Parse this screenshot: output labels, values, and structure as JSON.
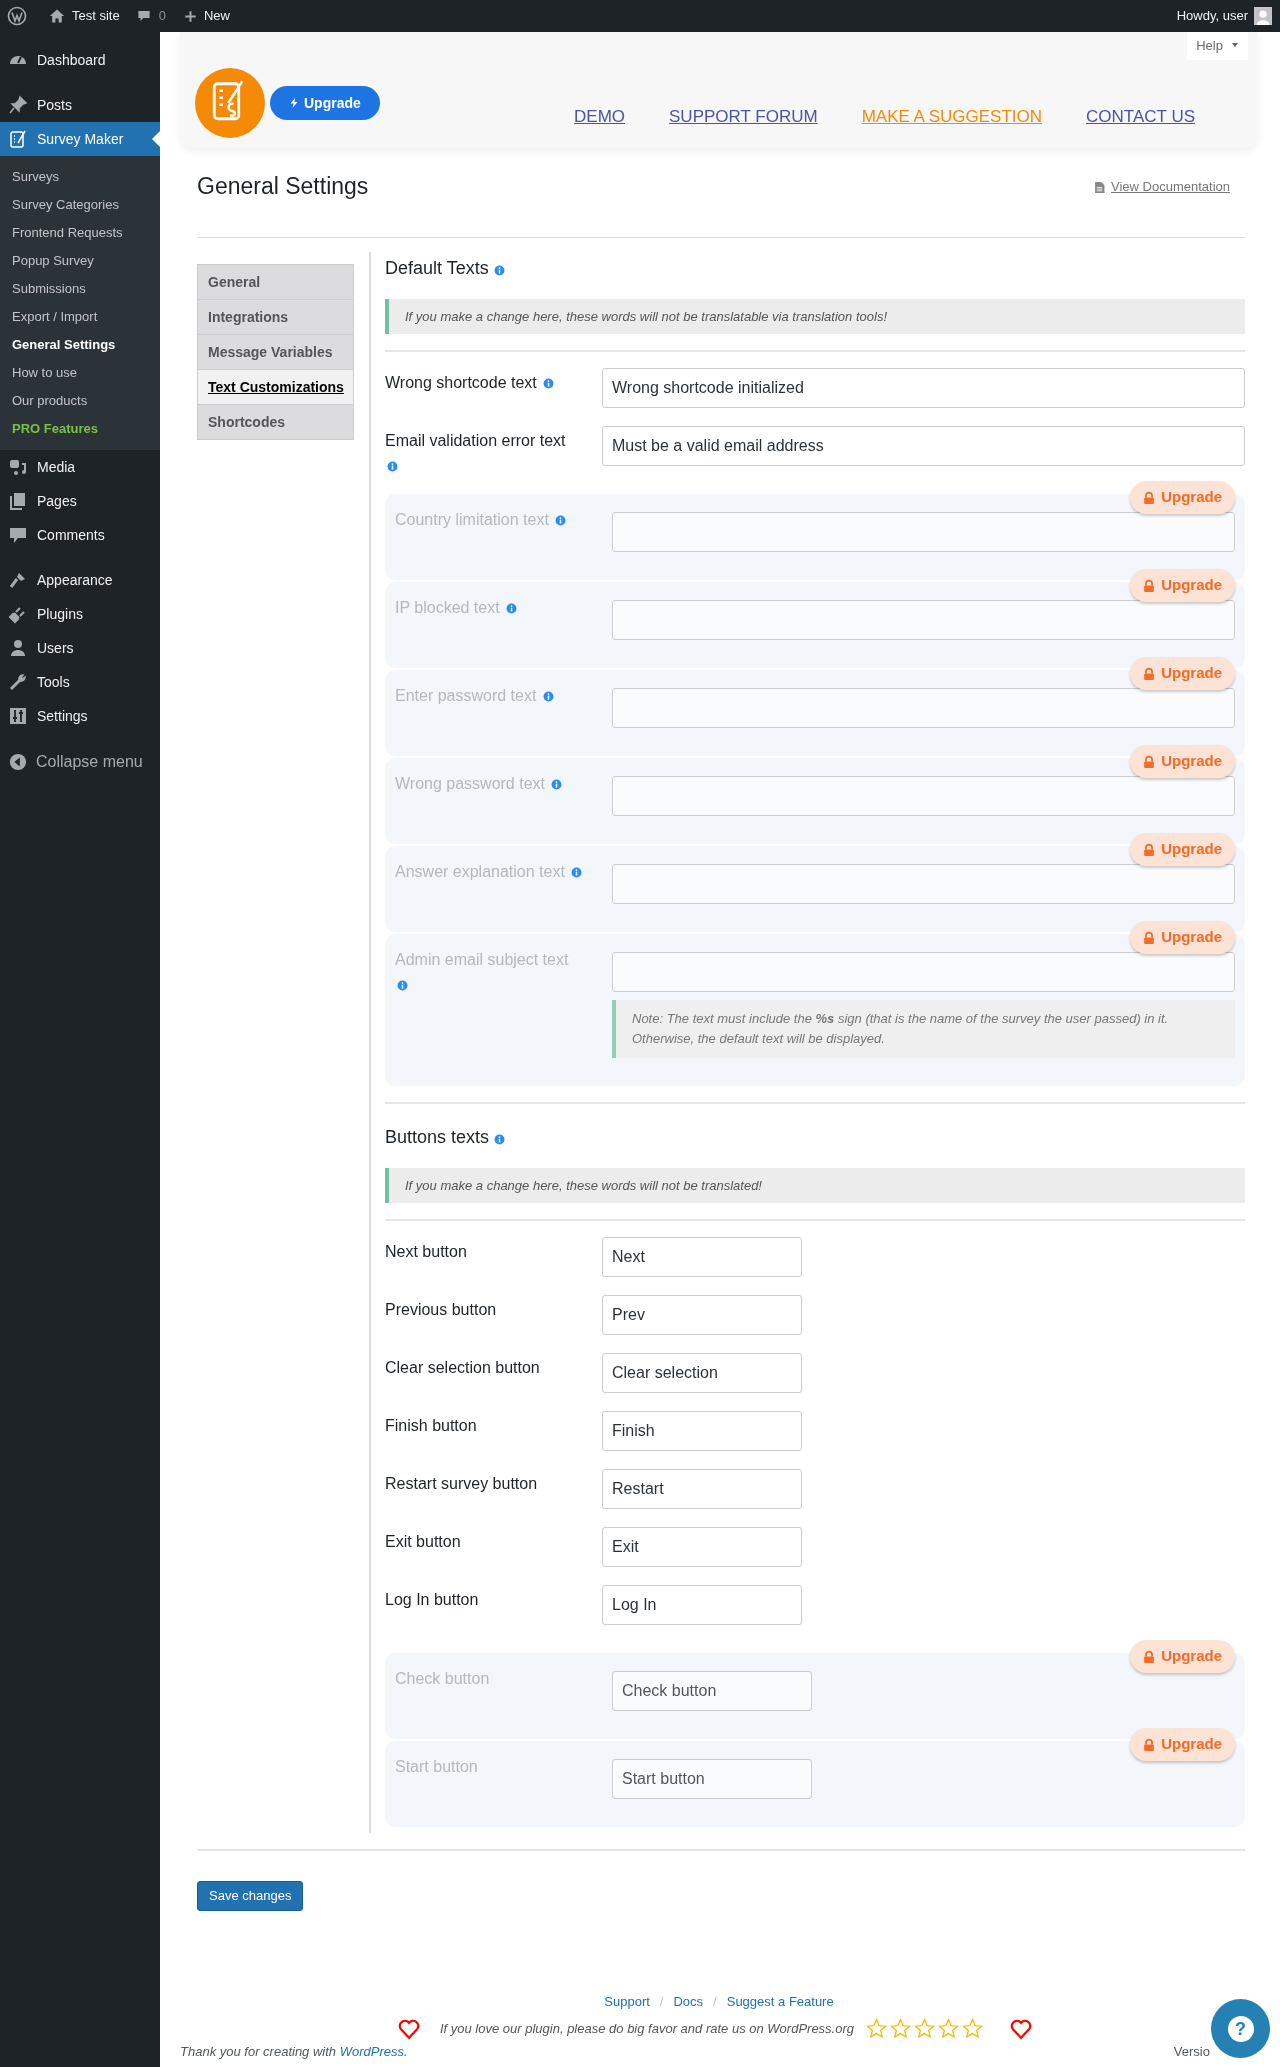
{
  "admin_bar": {
    "site": "Test site",
    "comments": "0",
    "new": "New",
    "greeting": "Howdy, user"
  },
  "sidebar": {
    "groups": [
      [
        {
          "label": "Dashboard",
          "selected": false
        }
      ],
      [
        {
          "label": "Posts",
          "selected": false
        },
        {
          "label": "Survey Maker",
          "selected": true,
          "children": [
            {
              "label": "Surveys",
              "kind": "link",
              "selected": false
            },
            {
              "label": "Survey Categories",
              "kind": "link",
              "selected": false
            },
            {
              "label": "Frontend Requests",
              "kind": "link",
              "selected": false
            },
            {
              "label": "Popup Survey",
              "kind": "link",
              "selected": false
            },
            {
              "label": "Submissions",
              "kind": "link",
              "selected": false
            },
            {
              "label": "Export / Import",
              "kind": "link",
              "selected": false
            },
            {
              "label": "General Settings",
              "kind": "link",
              "selected": true
            },
            {
              "label": "How to use",
              "kind": "link",
              "selected": false
            },
            {
              "label": "Our products",
              "kind": "link",
              "selected": false
            },
            {
              "label": "PRO Features",
              "kind": "pro",
              "selected": false
            }
          ]
        },
        {
          "label": "Media",
          "selected": false
        },
        {
          "label": "Pages",
          "selected": false
        },
        {
          "label": "Comments",
          "selected": false
        }
      ],
      [
        {
          "label": "Appearance",
          "selected": false
        },
        {
          "label": "Plugins",
          "selected": false
        },
        {
          "label": "Users",
          "selected": false
        },
        {
          "label": "Tools",
          "selected": false
        },
        {
          "label": "Settings",
          "selected": false
        }
      ]
    ],
    "collapse": "Collapse menu"
  },
  "header": {
    "upgrade": "Upgrade",
    "help": "Help",
    "links": [
      {
        "label": "DEMO",
        "highlighted": false
      },
      {
        "label": "SUPPORT FORUM",
        "highlighted": false
      },
      {
        "label": "MAKE A SUGGESTION",
        "highlighted": true
      },
      {
        "label": "CONTACT US",
        "highlighted": false
      }
    ]
  },
  "page": {
    "title": "General Settings",
    "doc_link": "View Documentation"
  },
  "tabs": [
    {
      "label": "General",
      "selected": false
    },
    {
      "label": "Integrations",
      "selected": false
    },
    {
      "label": "Message Variables",
      "selected": false
    },
    {
      "label": "Text Customizations",
      "selected": true
    },
    {
      "label": "Shortcodes",
      "selected": false
    }
  ],
  "sections": [
    {
      "title": "Default Texts",
      "kind": "texts",
      "notice": "If you make a change here, these words will not be translatable via translation tools!",
      "rows": [
        {
          "label": "Wrong shortcode text",
          "info": true,
          "locked": false,
          "value": "Wrong shortcode initialized"
        },
        {
          "label": "Email validation error text",
          "info": true,
          "locked": false,
          "value": "Must be a valid email address"
        },
        {
          "label": "Country limitation text",
          "info": true,
          "locked": true,
          "badge": "Upgrade"
        },
        {
          "label": "IP blocked text",
          "info": true,
          "locked": true,
          "badge": "Upgrade"
        },
        {
          "label": "Enter password text",
          "info": true,
          "locked": true,
          "badge": "Upgrade"
        },
        {
          "label": "Wrong password text",
          "info": true,
          "locked": true,
          "badge": "Upgrade"
        },
        {
          "label": "Answer explanation text",
          "info": true,
          "locked": true,
          "badge": "Upgrade"
        },
        {
          "label": "Admin email subject text",
          "info": true,
          "locked": true,
          "badge": "Upgrade",
          "note": "Note: The text must include the **%s** sign (that is the name of the survey the user passed) in it. Otherwise, the default text will be displayed."
        }
      ]
    },
    {
      "title": "Buttons texts",
      "kind": "buttons",
      "notice": "If you make a change here, these words will not be translated!",
      "rows": [
        {
          "label": "Next button",
          "info": false,
          "locked": false,
          "value": "Next"
        },
        {
          "label": "Previous button",
          "info": false,
          "locked": false,
          "value": "Prev"
        },
        {
          "label": "Clear selection button",
          "info": false,
          "locked": false,
          "value": "Clear selection"
        },
        {
          "label": "Finish button",
          "info": false,
          "locked": false,
          "value": "Finish"
        },
        {
          "label": "Restart survey button",
          "info": false,
          "locked": false,
          "value": "Restart"
        },
        {
          "label": "Exit button",
          "info": false,
          "locked": false,
          "value": "Exit"
        },
        {
          "label": "Log In button",
          "info": false,
          "locked": false,
          "value": "Log In"
        },
        {
          "label": "Check button",
          "info": false,
          "locked": true,
          "badge": "Upgrade",
          "value": "Check button"
        },
        {
          "label": "Start button",
          "info": false,
          "locked": true,
          "badge": "Upgrade",
          "value": "Start button"
        }
      ]
    }
  ],
  "save": "Save changes",
  "footer": {
    "links": [
      "Support",
      "Docs",
      "Suggest a Feature"
    ],
    "separator": "/",
    "rating_text": "If you love our plugin, please do big favor and rate us on WordPress.org",
    "stars": 0,
    "thanks": "Thank you for creating with ",
    "thanks_link": "WordPress",
    "thanks_end": ".",
    "version": "Versio",
    "help": "?"
  }
}
